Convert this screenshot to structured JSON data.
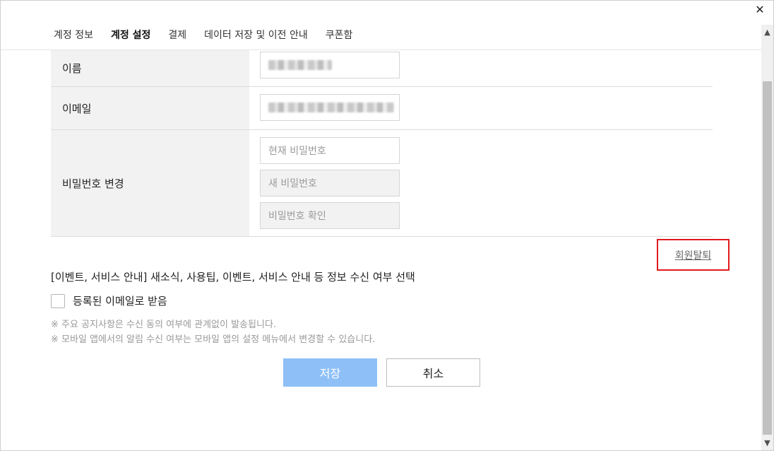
{
  "tabs": [
    "계정 정보",
    "계정 설정",
    "결제",
    "데이터 저장 및 이전 안내",
    "쿠폰함"
  ],
  "active_tab": "계정 설정",
  "form": {
    "name_label": "이름",
    "email_label": "이메일",
    "password_label": "비밀번호 변경",
    "current_password_placeholder": "현재 비밀번호",
    "new_password_placeholder": "새 비밀번호",
    "confirm_password_placeholder": "비밀번호 확인"
  },
  "withdraw_label": "회원탈퇴",
  "consent": {
    "title": "[이벤트, 서비스 안내] 새소식, 사용팁, 이벤트, 서비스 안내 등 정보 수신 여부 선택",
    "checkbox_label": "등록된 이메일로 받음",
    "checked": false,
    "note1": "※ 주요 공지사항은 수신 동의 여부에 관계없이 발송됩니다.",
    "note2": "※ 모바일 앱에서의 알림 수신 여부는 모바일 앱의 설정 메뉴에서 변경할 수 있습니다."
  },
  "buttons": {
    "save": "저장",
    "cancel": "취소"
  },
  "icons": {
    "close": "close-icon",
    "scroll_up": "chevron-up-icon",
    "scroll_down": "chevron-down-icon"
  },
  "colors": {
    "save_button": "#8ec0f7",
    "highlight_box": "#e0191e"
  }
}
